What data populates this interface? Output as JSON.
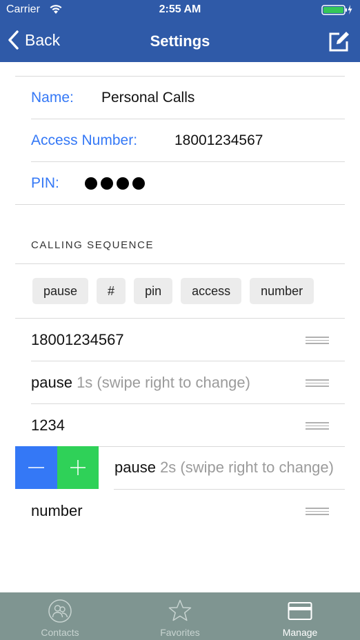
{
  "status_bar": {
    "carrier": "Carrier",
    "time": "2:55 AM",
    "wifi_icon": "wifi-icon",
    "battery_icon": "battery-charging-icon"
  },
  "nav": {
    "back_label": "Back",
    "title": "Settings",
    "edit_icon": "compose-icon"
  },
  "fields": {
    "name_label": "Name:",
    "name_value": "Personal Calls",
    "access_label": "Access Number:",
    "access_value": "18001234567",
    "pin_label": "PIN:",
    "pin_dot_count": 4
  },
  "calling_sequence": {
    "title": "CALLING SEQUENCE",
    "tokens": [
      "pause",
      "#",
      "pin",
      "access",
      "number"
    ],
    "steps": [
      {
        "main": "18001234567",
        "hint": ""
      },
      {
        "main": "pause",
        "hint": " 1s (swipe right to change)"
      },
      {
        "main": "1234",
        "hint": ""
      },
      {
        "main": "pause",
        "hint": " 2s (swipe right to change)"
      },
      {
        "main": "number",
        "hint": ""
      }
    ]
  },
  "colors": {
    "header": "#2f5aa8",
    "label_accent": "#3478f6",
    "minus": "#3478f6",
    "plus": "#2fd158",
    "tab_bar": "#7f9591"
  },
  "tab_bar": {
    "tabs": [
      {
        "label": "Contacts",
        "icon": "contacts-icon"
      },
      {
        "label": "Favorites",
        "icon": "star-icon"
      },
      {
        "label": "Manage",
        "icon": "card-icon"
      }
    ],
    "active": "Manage"
  }
}
